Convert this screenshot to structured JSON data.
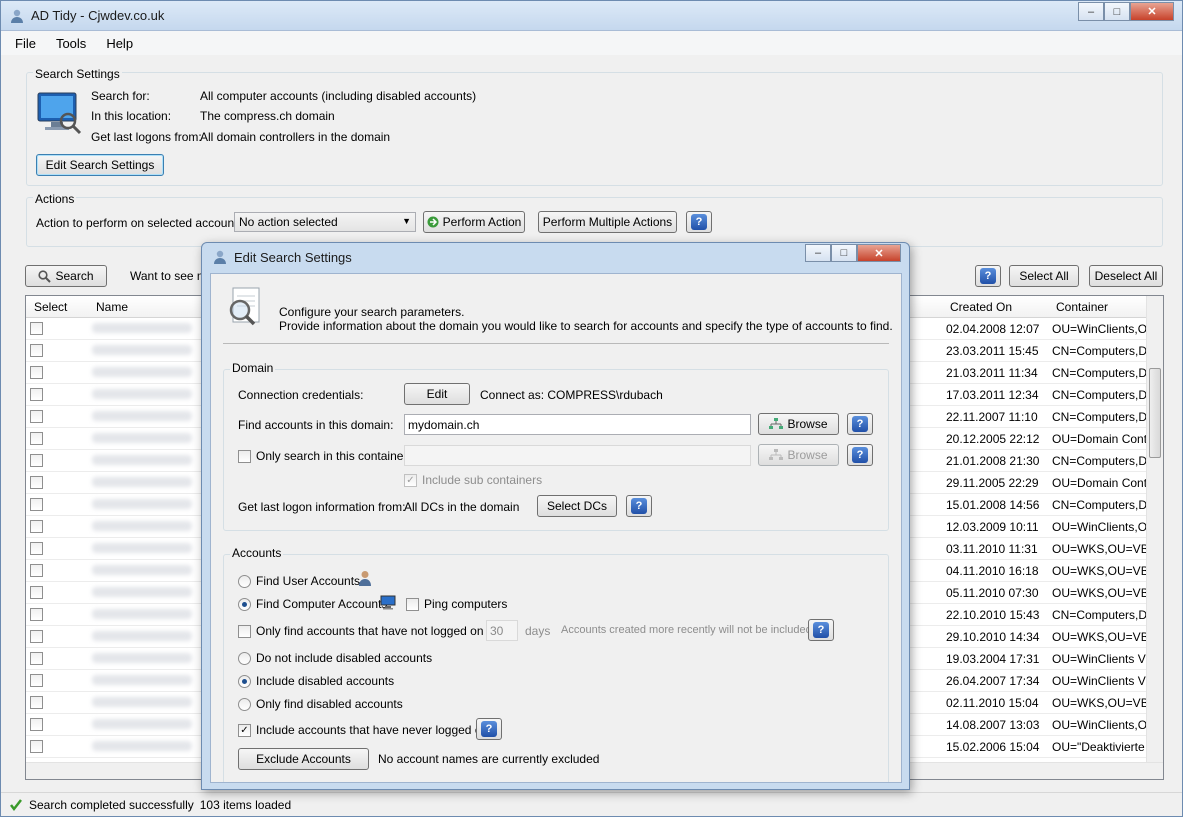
{
  "app": {
    "title": "AD Tidy - Cjwdev.co.uk",
    "menu": [
      "File",
      "Tools",
      "Help"
    ]
  },
  "search_settings": {
    "group_title": "Search Settings",
    "search_for_label": "Search for:",
    "search_for_value": "All computer accounts (including disabled accounts)",
    "location_label": "In this location:",
    "location_value": "The compress.ch domain",
    "logons_label": "Get last logons from:",
    "logons_value": "All domain controllers in the domain",
    "edit_button": "Edit Search Settings"
  },
  "actions": {
    "group_title": "Actions",
    "label": "Action to perform on selected accounts:",
    "selected_action": "No action selected",
    "perform_button": "Perform Action",
    "perform_multiple_button": "Perform Multiple Actions"
  },
  "toolbar": {
    "search_button": "Search",
    "hint_text": "Want to see mo",
    "select_all": "Select All",
    "deselect_all": "Deselect All"
  },
  "table": {
    "headers": {
      "select": "Select",
      "name": "Name",
      "created": "Created On",
      "container": "Container"
    },
    "rows": [
      {
        "created": "02.04.2008 12:07",
        "container": "OU=WinClients,OU="
      },
      {
        "created": "23.03.2011 15:45",
        "container": "CN=Computers,DC="
      },
      {
        "created": "21.03.2011 11:34",
        "container": "CN=Computers,DC="
      },
      {
        "created": "17.03.2011 12:34",
        "container": "CN=Computers,DC="
      },
      {
        "created": "22.11.2007 11:10",
        "container": "CN=Computers,DC="
      },
      {
        "created": "20.12.2005 22:12",
        "container": "OU=Domain Control"
      },
      {
        "created": "21.01.2008 21:30",
        "container": "CN=Computers,DC="
      },
      {
        "created": "29.11.2005 22:29",
        "container": "OU=Domain Control"
      },
      {
        "created": "15.01.2008 14:56",
        "container": "CN=Computers,DC="
      },
      {
        "created": "12.03.2009 10:11",
        "container": "OU=WinClients,OU="
      },
      {
        "created": "03.11.2010 11:31",
        "container": "OU=WKS,OU=VBM"
      },
      {
        "created": "04.11.2010 16:18",
        "container": "OU=WKS,OU=VBM"
      },
      {
        "created": "05.11.2010 07:30",
        "container": "OU=WKS,OU=VBM"
      },
      {
        "created": "22.10.2010 15:43",
        "container": "CN=Computers,DC="
      },
      {
        "created": "29.10.2010 14:34",
        "container": "OU=WKS,OU=VBM"
      },
      {
        "created": "19.03.2004 17:31",
        "container": "OU=WinClients VPN"
      },
      {
        "created": "26.04.2007 17:34",
        "container": "OU=WinClients VPN"
      },
      {
        "created": "02.11.2010 15:04",
        "container": "OU=WKS,OU=VBM"
      },
      {
        "created": "14.08.2007 13:03",
        "container": "OU=WinClients,OU="
      },
      {
        "created": "15.02.2006 15:04",
        "container": "OU=\"Deaktivierte Cl"
      }
    ]
  },
  "status": {
    "message": "Search completed successfully",
    "count": "103 items loaded"
  },
  "dialog": {
    "title": "Edit Search Settings",
    "intro_line1": "Configure your search parameters.",
    "intro_line2": "Provide information about the domain you would like to search for accounts and specify the type of accounts to find.",
    "domain": {
      "group_title": "Domain",
      "credentials_label": "Connection credentials:",
      "edit_button": "Edit",
      "connect_as": "Connect as: COMPRESS\\rdubach",
      "find_in_label": "Find accounts in this domain:",
      "domain_value": "mydomain.ch",
      "browse_button": "Browse",
      "only_container_label": "Only search in this container:",
      "container_value": "",
      "browse_container_button": "Browse",
      "include_sub_label": "Include sub containers",
      "logon_info_label": "Get last logon information from:",
      "logon_info_value": "All DCs in the domain",
      "select_dcs_button": "Select DCs"
    },
    "accounts": {
      "group_title": "Accounts",
      "find_users": "Find User Accounts",
      "find_computers": "Find Computer Accounts",
      "ping_computers": "Ping computers",
      "not_logged_on_label": "Only find accounts that have not logged on for:",
      "days_value": "30",
      "days_label": "days",
      "recent_note": "Accounts created more recently will not be included",
      "no_disabled": "Do not include disabled accounts",
      "include_disabled": "Include disabled accounts",
      "only_disabled": "Only find disabled accounts",
      "never_logged_on": "Include accounts that have never logged on",
      "exclude_button": "Exclude Accounts",
      "exclude_status": "No account names are currently excluded"
    }
  },
  "colors": {
    "title_gradient_top": "#dce9f7",
    "window_bg": "#f0f0f0",
    "help_icon": "#2150a8"
  }
}
